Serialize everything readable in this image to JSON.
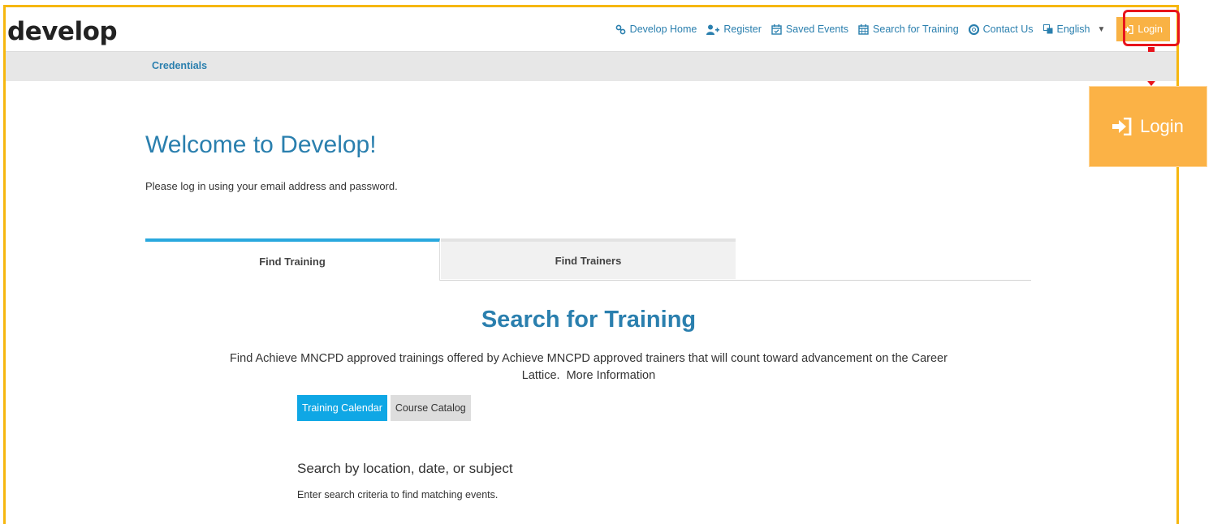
{
  "app": {
    "logo": "develop"
  },
  "nav": {
    "items": [
      {
        "label": "Develop Home",
        "icon": "link-icon"
      },
      {
        "label": "Register",
        "icon": "add-user-icon"
      },
      {
        "label": "Saved Events",
        "icon": "calendar-check-icon"
      },
      {
        "label": "Search for Training",
        "icon": "calendar-icon"
      },
      {
        "label": "Contact Us",
        "icon": "life-ring-icon"
      }
    ],
    "language": "English",
    "login": "Login"
  },
  "callout": {
    "login": "Login"
  },
  "subnav": {
    "credentials": "Credentials"
  },
  "page": {
    "title": "Welcome to Develop!",
    "intro": "Please log in using your email address and password."
  },
  "tabs": [
    {
      "label": "Find Training",
      "active": true
    },
    {
      "label": "Find Trainers",
      "active": false
    }
  ],
  "search": {
    "title": "Search for Training",
    "description": "Find Achieve MNCPD approved trainings offered by Achieve MNCPD approved trainers that will count toward advancement on the Career Lattice.",
    "more_info": "More Information",
    "buttons": {
      "calendar": "Training Calendar",
      "catalog": "Course Catalog"
    },
    "section_heading": "Search by location, date, or subject",
    "section_sub": "Enter search criteria to find matching events."
  },
  "colors": {
    "accent": "#2a7fae",
    "frame": "#f6b70f",
    "login": "#f9b244",
    "highlight": "#e8141c",
    "primary_button": "#0fa7e5"
  }
}
